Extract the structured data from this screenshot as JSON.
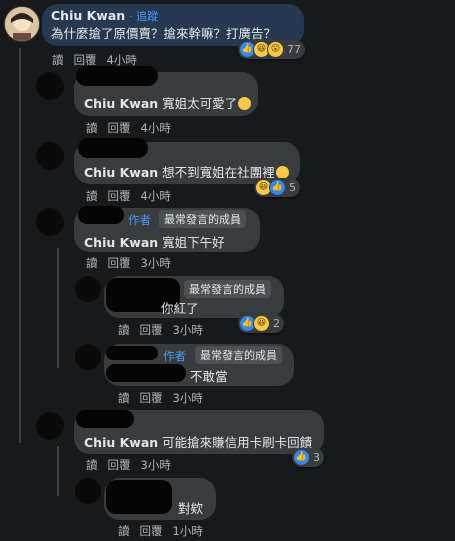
{
  "top_comment": {
    "author": "Chiu Kwan",
    "follow": "· 追蹤",
    "text": "為什麼搶了原價賣？搶來幹嘛？打廣告？",
    "reaction_count": "77"
  },
  "actions": {
    "like": "讀",
    "reply": "回覆"
  },
  "replies": [
    {
      "mention": "Chiu Kwan",
      "text": "寬姐太可愛了",
      "time": "4小時"
    },
    {
      "mention": "Chiu Kwan",
      "text": "想不到寬姐在社團裡",
      "time": "4小時",
      "reaction_count": "5"
    },
    {
      "author_badge": "作者",
      "tag": "最常發言的成員",
      "mention": "Chiu Kwan",
      "text": "寬姐下午好",
      "time": "3小時"
    },
    {
      "tag": "最常發言的成員",
      "text": "你紅了",
      "time": "3小時",
      "reaction_count": "2"
    },
    {
      "author_badge": "作者",
      "tag": "最常發言的成員",
      "text": "不敢當",
      "time": "3小時"
    },
    {
      "mention": "Chiu Kwan",
      "text": "可能搶來賺信用卡刷卡回饋",
      "time": "3小時",
      "reaction_count": "3"
    },
    {
      "text": "對欸",
      "time": "1小時"
    }
  ],
  "top_time": "4小時"
}
